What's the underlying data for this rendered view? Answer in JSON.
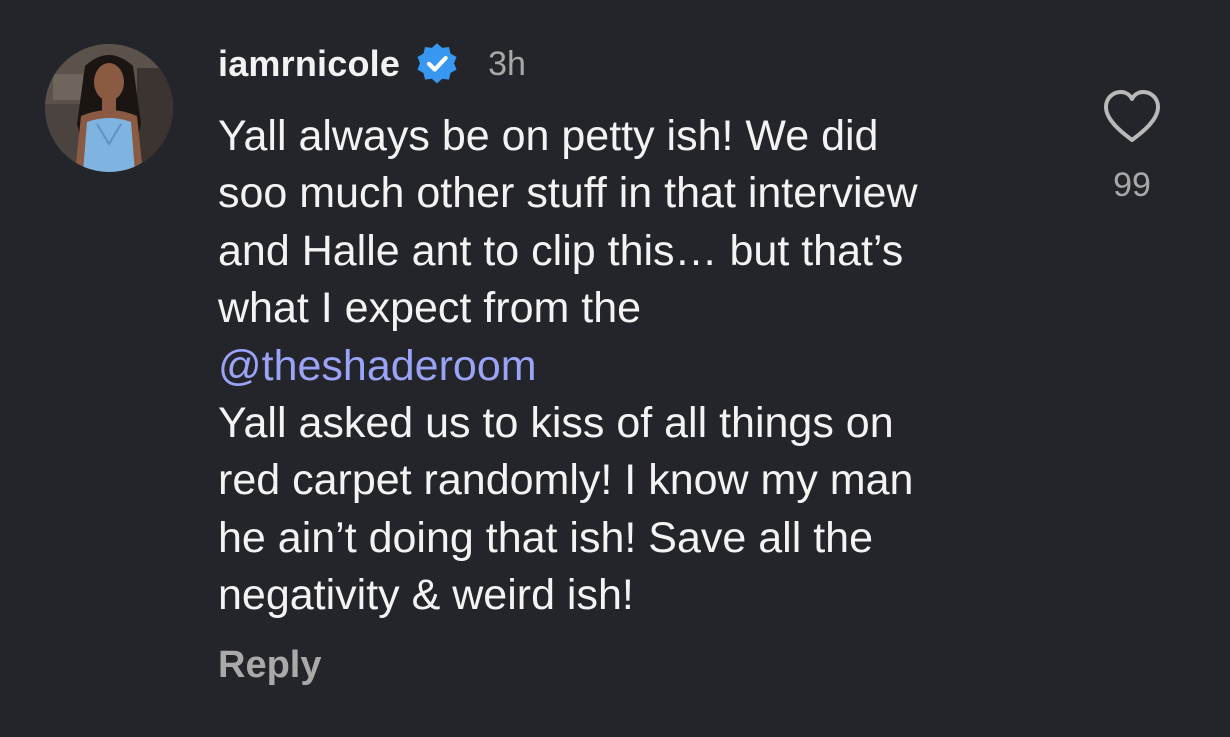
{
  "comment": {
    "username": "iamrnicole",
    "verified_icon": "verified-badge-icon",
    "timestamp": "3h",
    "text_lines": [
      "Yall always be on petty ish! We did",
      "soo much other stuff in that interview",
      "and Halle ant to clip this… but that’s",
      "what I expect from the"
    ],
    "mention": "@theshaderoom",
    "text_lines_after": [
      "Yall asked us to kiss of all things on",
      "red carpet randomly! I know my man",
      "he ain’t doing that ish! Save all the",
      "negativity & weird ish!"
    ],
    "reply_label": "Reply",
    "like_icon": "heart-icon",
    "like_count": "99"
  },
  "colors": {
    "background": "#23252a",
    "text": "#f3f3f3",
    "muted": "#a8a8a8",
    "mention": "#9aa3f5",
    "verified": "#3897f0"
  }
}
